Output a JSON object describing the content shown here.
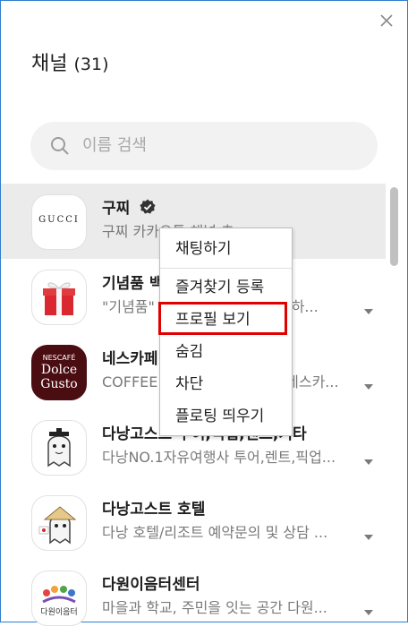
{
  "header": {
    "title": "채널",
    "count": "(31)"
  },
  "search": {
    "placeholder": "이름 검색"
  },
  "channels": [
    {
      "name": "구찌",
      "desc": "구찌 카카오톡 채널 추",
      "verified": true,
      "logo": "GUCCI"
    },
    {
      "name": "기념품 백",
      "desc": "\"기념품\" 고객님을 위한 구추가 하..."
    },
    {
      "name": "네스카페",
      "desc": "COFFEE 돌체구스토 NESCK 네스카...",
      "logo_top": "NESCAFÉ",
      "logo_mid": "Dolce",
      "logo_bot": "Gusto"
    },
    {
      "name": "다낭고스트 투어,픽업,렌트,기타",
      "desc": "다낭NO.1자유여행사 투어,렌트,픽업..."
    },
    {
      "name": "다낭고스트 호텔",
      "desc": "다낭 호텔/리조트 예약문의 및 상담 ..."
    },
    {
      "name": "다원이음터센터",
      "desc": "마을과 학교, 주민을 잇는 공간 다원...",
      "logo": "다원이음터"
    }
  ],
  "context_menu": {
    "items": [
      "채팅하기",
      "즐겨찾기 등록",
      "프로필 보기",
      "숨김",
      "차단",
      "플로팅 띄우기"
    ]
  },
  "colors": {
    "border": "#2f7fd0",
    "highlight": "#e00000",
    "hover": "#ebebeb"
  }
}
